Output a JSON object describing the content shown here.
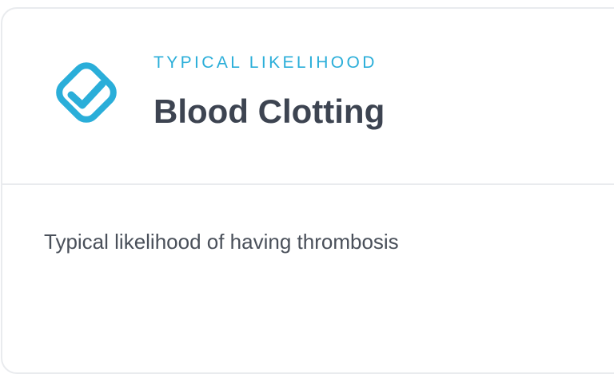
{
  "card": {
    "eyebrow": "TYPICAL LIKELIHOOD",
    "title": "Blood Clotting",
    "description": "Typical likelihood of having thrombosis",
    "icon": "check-diamond-icon",
    "colors": {
      "accent": "#2aaed9",
      "title": "#3d4451",
      "body": "#4a505a",
      "border": "#e9ebee"
    }
  }
}
